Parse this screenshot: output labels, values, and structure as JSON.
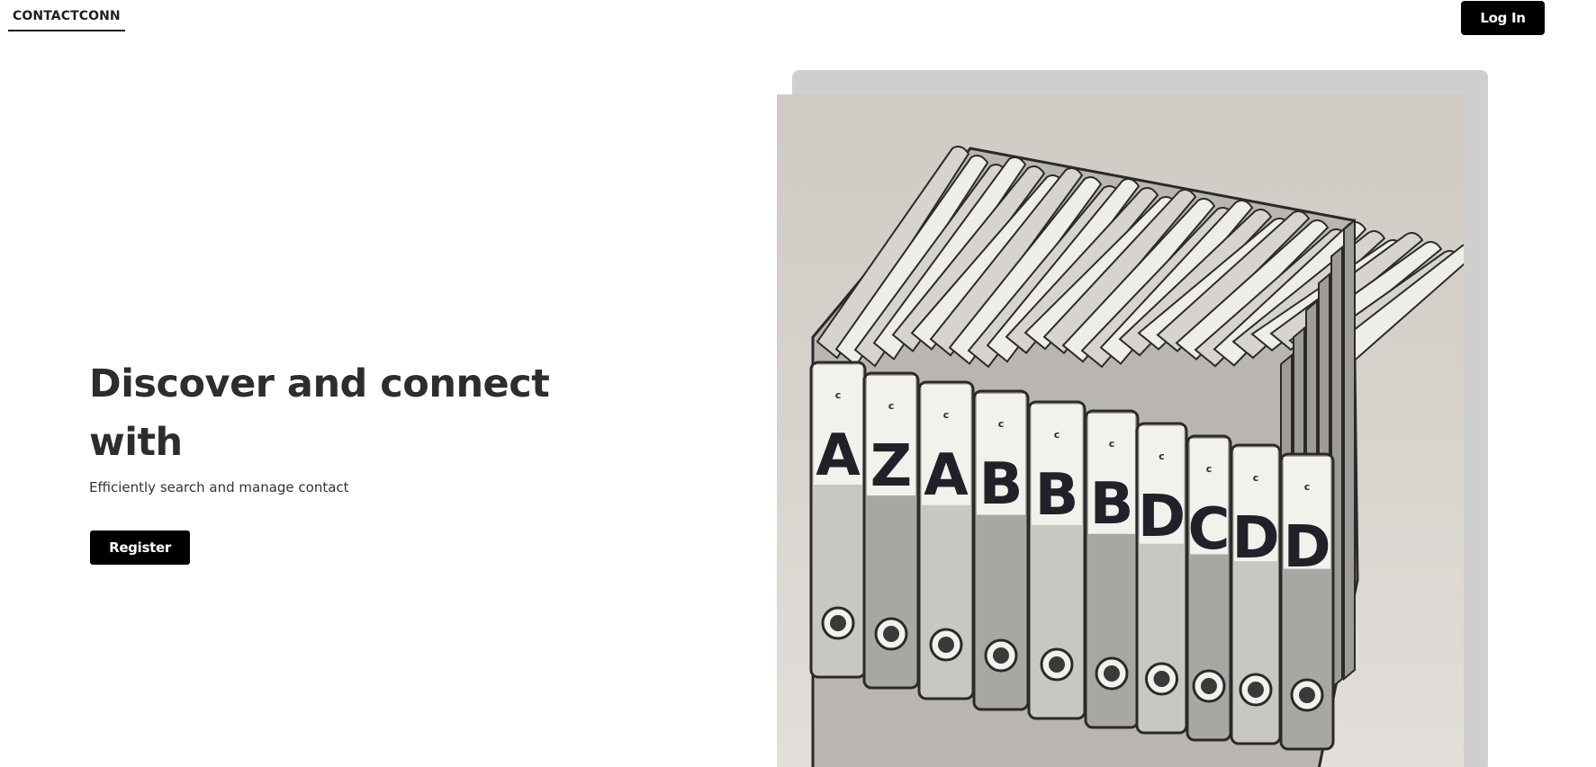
{
  "header": {
    "brand": "CONTACTCONN",
    "login_label": "Log In"
  },
  "hero": {
    "title": "Discover and connect with",
    "subtitle": "Efficiently search and manage contact",
    "register_label": "Register"
  },
  "illustration": {
    "binder_letters": [
      "A",
      "Z",
      "A",
      "B",
      "B",
      "B",
      "D",
      "C",
      "D",
      "D"
    ]
  },
  "colors": {
    "button_bg": "#000000",
    "button_text": "#ffffff",
    "text_dark": "#2d2d2d",
    "shadow_card": "#cfcfcf"
  }
}
